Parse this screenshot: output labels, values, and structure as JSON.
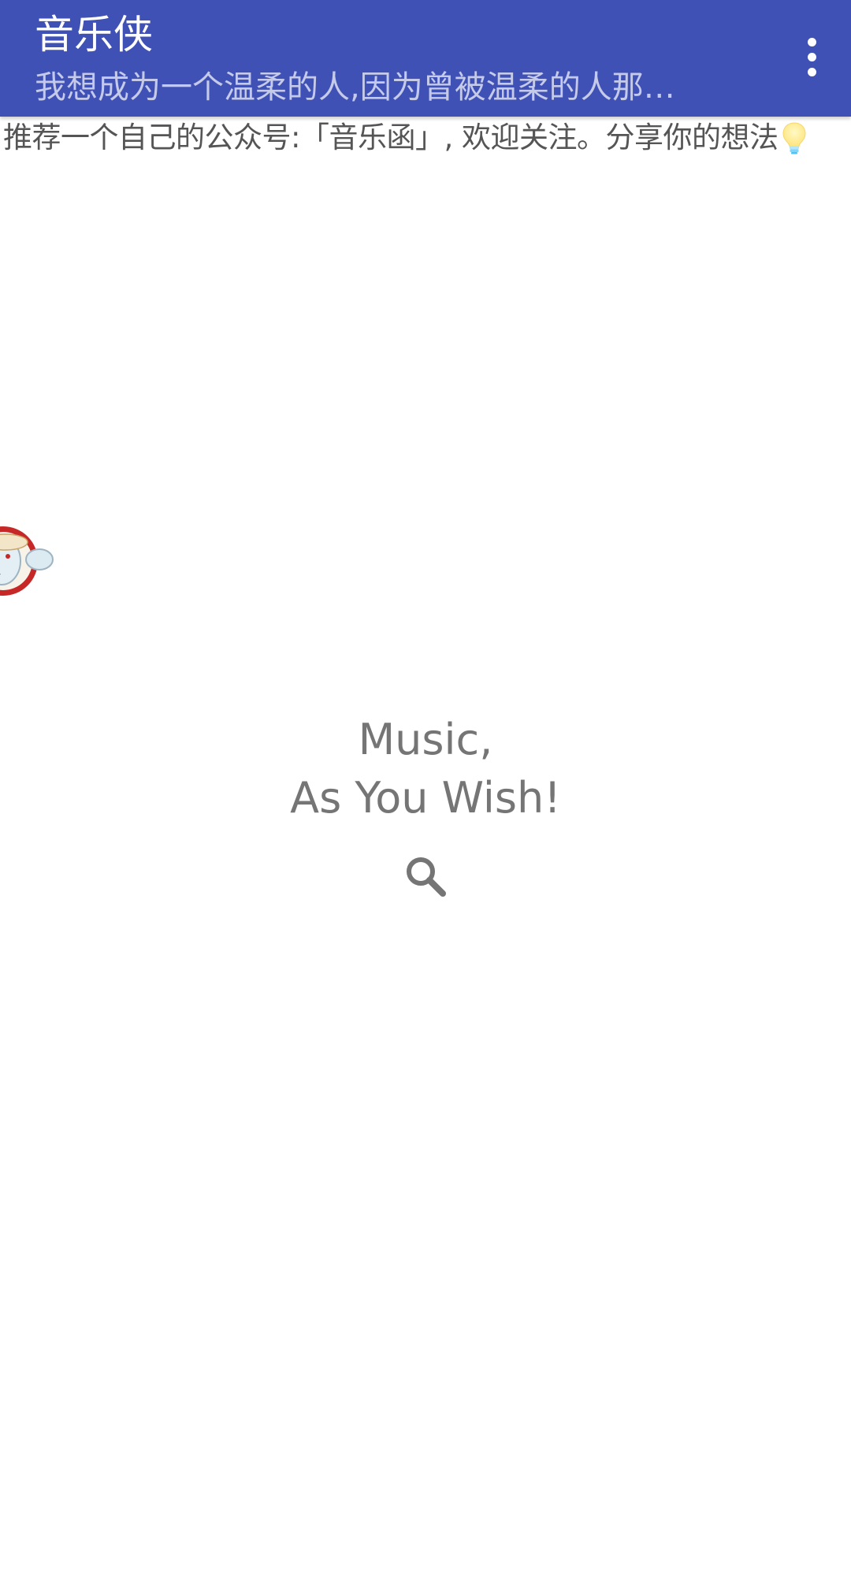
{
  "app_bar": {
    "title": "音乐侠",
    "subtitle": "我想成为一个温柔的人,因为曾被温柔的人那…",
    "overflow_icon": "more-vert-icon",
    "background_color": "#3F51B5",
    "subtitle_color": "#C5CAE9"
  },
  "notice": {
    "text": "推荐一个自己的公众号:「音乐函」, 欢迎关注。分享你的想法",
    "icon": "lightbulb-icon"
  },
  "floating_widget": {
    "icon": "floating-avatar-icon"
  },
  "slogan": {
    "line1": "Music,",
    "line2": "As You Wish!"
  },
  "search": {
    "icon": "search-icon"
  }
}
